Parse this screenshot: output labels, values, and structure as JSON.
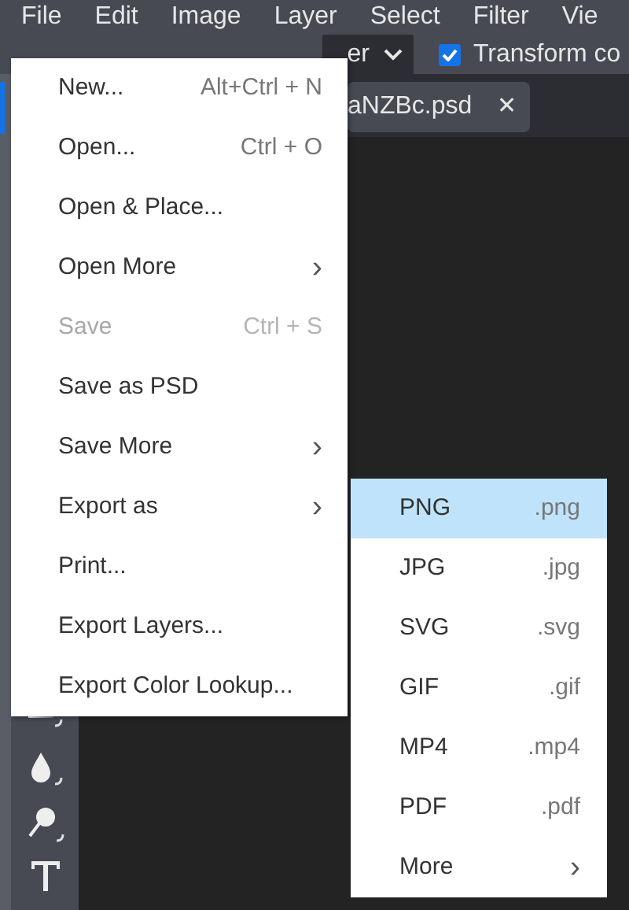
{
  "menubar": [
    {
      "label": "File"
    },
    {
      "label": "Edit"
    },
    {
      "label": "Image"
    },
    {
      "label": "Layer"
    },
    {
      "label": "Select"
    },
    {
      "label": "Filter"
    },
    {
      "label": "Vie"
    }
  ],
  "options_bar": {
    "dropdown": {
      "value": "er"
    },
    "transform_checkbox": {
      "label": "Transform co",
      "checked": true
    }
  },
  "document_tab": {
    "title": "aNZBc.psd",
    "close": "✕"
  },
  "file_menu": [
    {
      "kind": "command",
      "label": "New...",
      "shortcut": "Alt+Ctrl + N",
      "disabled": false
    },
    {
      "kind": "command",
      "label": "Open...",
      "shortcut": "Ctrl + O",
      "disabled": false
    },
    {
      "kind": "command",
      "label": "Open & Place...",
      "disabled": false
    },
    {
      "kind": "submenu",
      "label": "Open More",
      "arrow": "›",
      "disabled": false
    },
    {
      "kind": "command",
      "label": "Save",
      "shortcut": "Ctrl + S",
      "disabled": true
    },
    {
      "kind": "command",
      "label": "Save as PSD",
      "disabled": false
    },
    {
      "kind": "submenu",
      "label": "Save More",
      "arrow": "›",
      "disabled": false
    },
    {
      "kind": "submenu",
      "label": "Export as",
      "arrow": "›",
      "disabled": false
    },
    {
      "kind": "command",
      "label": "Print...",
      "disabled": false
    },
    {
      "kind": "command",
      "label": "Export Layers...",
      "disabled": false
    },
    {
      "kind": "command",
      "label": "Export Color Lookup...",
      "disabled": false
    }
  ],
  "export_submenu": [
    {
      "kind": "format",
      "label": "PNG",
      "extension": ".png",
      "selected": true
    },
    {
      "kind": "format",
      "label": "JPG",
      "extension": ".jpg",
      "selected": false
    },
    {
      "kind": "format",
      "label": "SVG",
      "extension": ".svg",
      "selected": false
    },
    {
      "kind": "format",
      "label": "GIF",
      "extension": ".gif",
      "selected": false
    },
    {
      "kind": "format",
      "label": "MP4",
      "extension": ".mp4",
      "selected": false
    },
    {
      "kind": "format",
      "label": "PDF",
      "extension": ".pdf",
      "selected": false
    },
    {
      "kind": "submenu",
      "label": "More",
      "arrow": "›",
      "selected": false
    }
  ]
}
